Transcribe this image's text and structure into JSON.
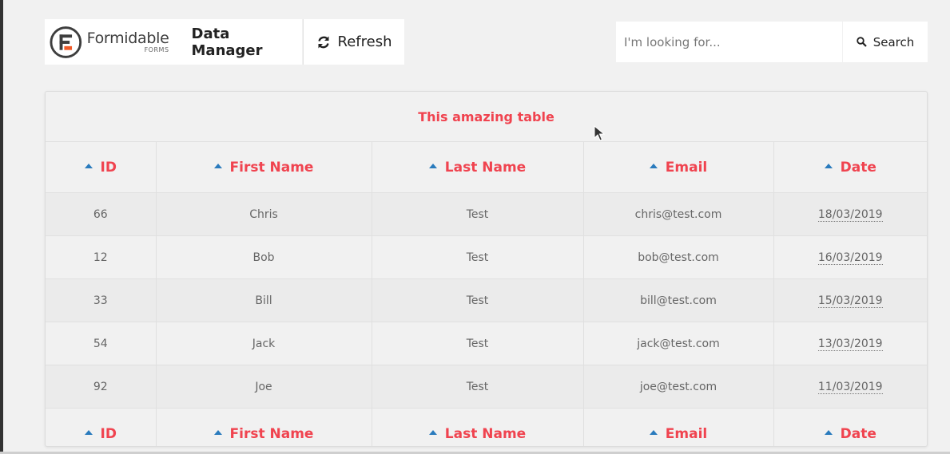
{
  "header": {
    "logo_main": "Formidable",
    "logo_sub": "FORMS",
    "app_title": "Data Manager",
    "refresh_label": "Refresh",
    "refresh_icon": "refresh-icon"
  },
  "search": {
    "placeholder": "I'm looking for...",
    "value": "",
    "button_label": "Search",
    "icon": "search-icon"
  },
  "table": {
    "caption": "This amazing table",
    "columns": [
      "ID",
      "First Name",
      "Last Name",
      "Email",
      "Date"
    ],
    "rows": [
      [
        "66",
        "Chris",
        "Test",
        "chris@test.com",
        "18/03/2019"
      ],
      [
        "12",
        "Bob",
        "Test",
        "bob@test.com",
        "16/03/2019"
      ],
      [
        "33",
        "Bill",
        "Test",
        "bill@test.com",
        "15/03/2019"
      ],
      [
        "54",
        "Jack",
        "Test",
        "jack@test.com",
        "13/03/2019"
      ],
      [
        "92",
        "Joe",
        "Test",
        "joe@test.com",
        "11/03/2019"
      ]
    ]
  },
  "colors": {
    "accent": "#f0434f",
    "sort_arrow": "#2a7bbd",
    "logo_orange": "#f05a28",
    "background": "#f1f1f1"
  }
}
